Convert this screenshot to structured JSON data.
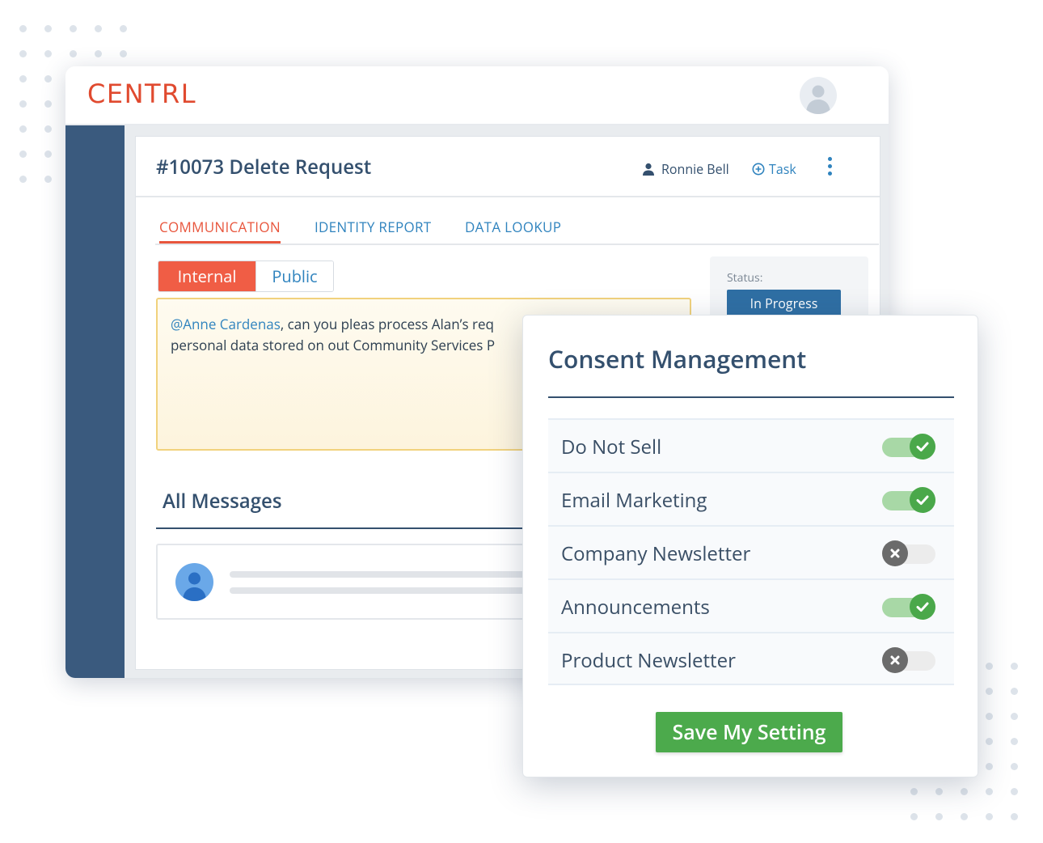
{
  "app": {
    "logo_text": "CENTRL"
  },
  "request": {
    "title": "#10073 Delete Request",
    "assignee": "Ronnie Bell",
    "task_label": "Task"
  },
  "tabs": [
    {
      "label": "COMMUNICATION",
      "active": true
    },
    {
      "label": "IDENTITY REPORT",
      "active": false
    },
    {
      "label": "DATA LOOKUP",
      "active": false
    }
  ],
  "visibility_toggle": {
    "internal_label": "Internal",
    "public_label": "Public",
    "selected": "Internal"
  },
  "note": {
    "mention": "@Anne Cardenas",
    "line1_rest": ", can you pleas process Alan’s req",
    "line2": "personal data stored on out Community Services P"
  },
  "status": {
    "label": "Status:",
    "value": "In Progress"
  },
  "messages": {
    "title": "All Messages"
  },
  "consent": {
    "title": "Consent Management",
    "preferences": [
      {
        "label": "Do Not Sell",
        "enabled": true
      },
      {
        "label": "Email Marketing",
        "enabled": true
      },
      {
        "label": "Company Newsletter",
        "enabled": false
      },
      {
        "label": "Announcements",
        "enabled": true
      },
      {
        "label": "Product Newsletter",
        "enabled": false
      }
    ],
    "save_label": "Save My Setting"
  },
  "colors": {
    "brand": "#e04a2f",
    "sidebar": "#3a5a7e",
    "link": "#2f83be",
    "active_tab": "#e8553c",
    "toggle_on": "#4aa84a",
    "toggle_off": "#6b6b6b",
    "save": "#4caa4c"
  }
}
